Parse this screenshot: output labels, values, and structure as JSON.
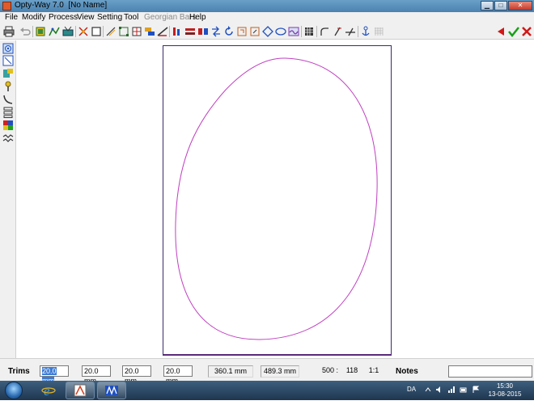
{
  "window": {
    "title": "Opty-Way 7.0  [No Name]",
    "minimize_glyph": "▁",
    "maximize_glyph": "□",
    "close_glyph": "✕"
  },
  "menu": {
    "items": [
      {
        "label": "File",
        "enabled": true
      },
      {
        "label": "Modify",
        "enabled": true
      },
      {
        "label": "Process",
        "enabled": true
      },
      {
        "label": "View",
        "enabled": true
      },
      {
        "label": "Setting",
        "enabled": true
      },
      {
        "label": "Tool",
        "enabled": true
      },
      {
        "label": "Georgian Bars",
        "enabled": false
      },
      {
        "label": "Help",
        "enabled": true
      }
    ]
  },
  "toolbar": {
    "icons": [
      "print-icon",
      "undo-icon",
      "glass-piece-icon",
      "shape-draw-icon",
      "cut-table-icon",
      "cross-tool-icon",
      "rectangle-icon",
      "diagonal-icon",
      "corners-icon",
      "grid-square-icon",
      "stack-icon",
      "measure-icon",
      "bars-icon",
      "rack-icon",
      "pair-icon",
      "arrows-icon",
      "rotate-icon",
      "trim-icon",
      "resize-icon",
      "diamond-icon",
      "ellipse-icon",
      "wave-icon",
      "table-grid-icon",
      "arc-icon",
      "slant-icon",
      "cross-line-icon",
      "anchor-icon",
      "dots-grid-icon"
    ],
    "right_icons": [
      "back-red-icon",
      "confirm-check-icon",
      "cancel-x-icon"
    ]
  },
  "left_toolbar": {
    "icons": [
      "target-icon",
      "select-area-icon",
      "layers-icon",
      "pin-icon",
      "curve-icon",
      "stack-tree-icon",
      "palette-icon",
      "zigzag-icon"
    ]
  },
  "colors": {
    "shape_stroke": "#c040c0",
    "sheet_border": "#3a2a6a",
    "selection": "#3b7bd4"
  },
  "status": {
    "trims_label": "Trims",
    "trim_values": [
      "20.0 mm",
      "20.0 mm",
      "20.0 mm",
      "20.0 mm"
    ],
    "width_readout": "360.1 mm",
    "height_readout": "489.3 mm",
    "code_left": "500 :",
    "code_right": "118",
    "scale": "1:1",
    "notes_label": "Notes",
    "notes_value": ""
  },
  "taskbar": {
    "language": "DA",
    "time": "15:30",
    "date": "13-08-2015"
  }
}
